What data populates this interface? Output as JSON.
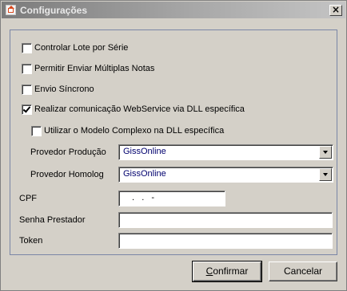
{
  "window": {
    "title": "Configurações",
    "close_symbol": "×"
  },
  "options": {
    "controlar_lote": {
      "label": "Controlar Lote por Série",
      "checked": false
    },
    "multiplas_notas": {
      "label": "Permitir Enviar Múltiplas Notas",
      "checked": false
    },
    "envio_sincrono": {
      "label": "Envio Síncrono",
      "checked": false
    },
    "dll_especifica": {
      "label": "Realizar comunicação WebService via DLL específica",
      "checked": true
    },
    "modelo_complexo": {
      "label": "Utilizar o Modelo Complexo na DLL específica",
      "checked": false
    }
  },
  "provedor_producao": {
    "label": "Provedor Produção",
    "value": "GissOnline"
  },
  "provedor_homolog": {
    "label": "Provedor Homolog",
    "value": "GissOnline"
  },
  "cpf": {
    "label": "CPF",
    "value": " .  .  -"
  },
  "senha": {
    "label": "Senha Prestador",
    "value": ""
  },
  "token": {
    "label": "Token",
    "value": ""
  },
  "buttons": {
    "confirmar": {
      "first": "C",
      "rest": "onfirmar"
    },
    "cancelar": "Cancelar"
  }
}
